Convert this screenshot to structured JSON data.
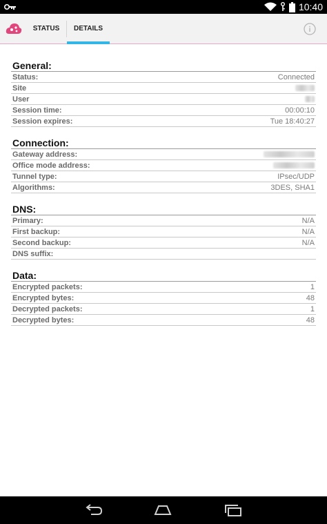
{
  "status_bar": {
    "time": "10:40"
  },
  "tabs": [
    {
      "label": "STATUS"
    },
    {
      "label": "DETAILS"
    }
  ],
  "colors": {
    "accent": "#33b5e5",
    "brand": "#e0457b"
  },
  "sections": {
    "general": {
      "title": "General:",
      "rows": [
        {
          "label": "Status:",
          "value": "Connected"
        },
        {
          "label": "Site",
          "value": ""
        },
        {
          "label": "User",
          "value": ""
        },
        {
          "label": "Session time:",
          "value": "00:00:10"
        },
        {
          "label": "Session expires:",
          "value": "Tue 18:40:27"
        }
      ]
    },
    "connection": {
      "title": "Connection:",
      "rows": [
        {
          "label": "Gateway address:",
          "value": ""
        },
        {
          "label": "Office mode address:",
          "value": ""
        },
        {
          "label": "Tunnel type:",
          "value": "IPsec/UDP"
        },
        {
          "label": "Algorithms:",
          "value": "3DES, SHA1"
        }
      ]
    },
    "dns": {
      "title": "DNS:",
      "rows": [
        {
          "label": "Primary:",
          "value": "N/A"
        },
        {
          "label": "First backup:",
          "value": "N/A"
        },
        {
          "label": "Second backup:",
          "value": "N/A"
        },
        {
          "label": "DNS suffix:",
          "value": ""
        }
      ]
    },
    "data": {
      "title": "Data:",
      "rows": [
        {
          "label": "Encrypted packets:",
          "value": "1"
        },
        {
          "label": "Encrypted bytes:",
          "value": "48"
        },
        {
          "label": "Decrypted packets:",
          "value": "1"
        },
        {
          "label": "Decrypted bytes:",
          "value": "48"
        }
      ]
    }
  }
}
